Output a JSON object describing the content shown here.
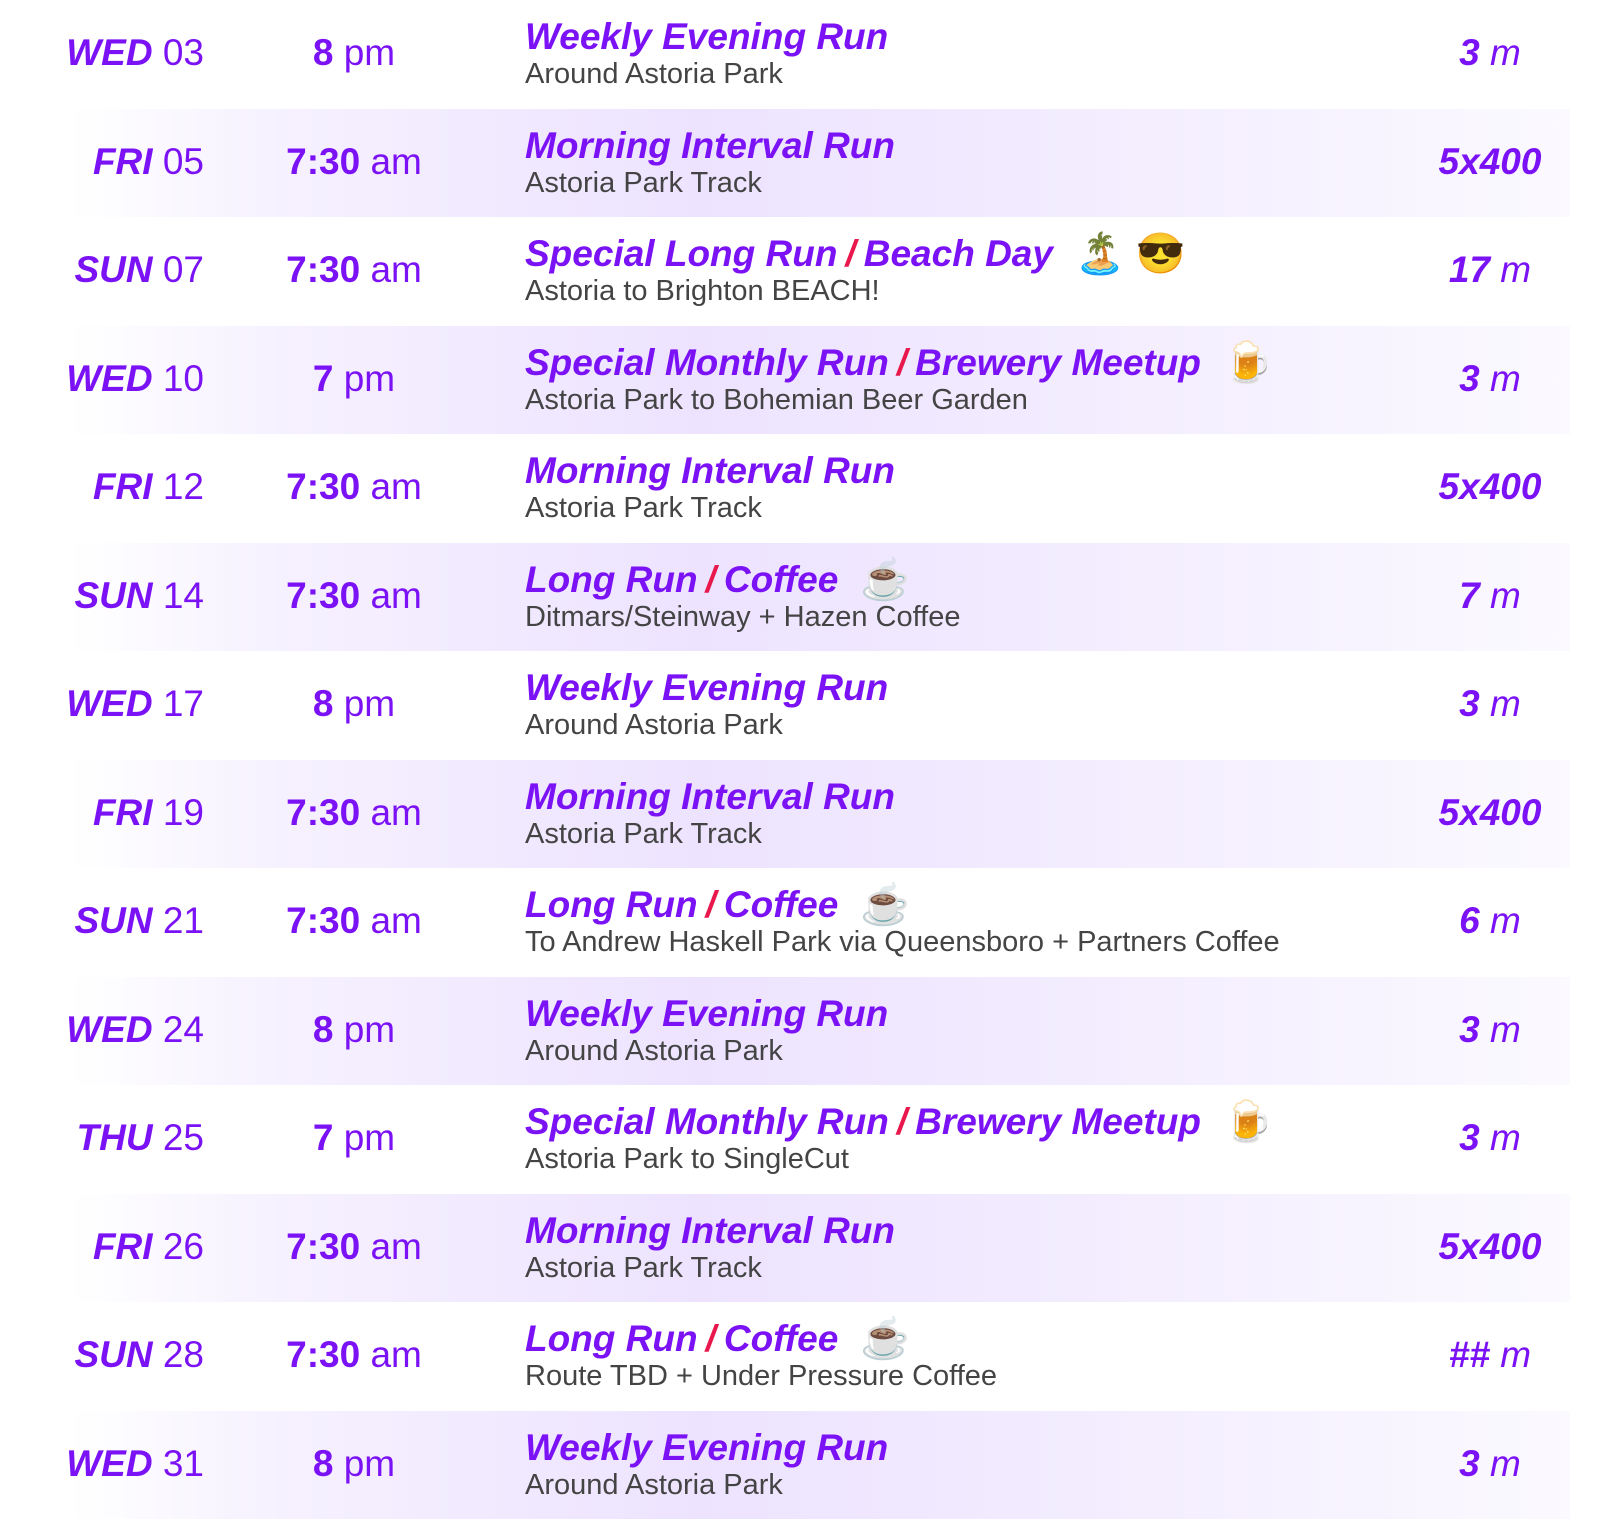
{
  "schedule": [
    {
      "day": "WED",
      "date": "03",
      "time": "8",
      "ampm": "pm",
      "title_a": "Weekly Evening Run",
      "title_b": "",
      "emoji": "",
      "subtitle": "Around Astoria Park",
      "distance": "3",
      "unit": "m",
      "shaded": false
    },
    {
      "day": "FRI",
      "date": "05",
      "time": "7:30",
      "ampm": "am",
      "title_a": "Morning Interval Run",
      "title_b": "",
      "emoji": "",
      "subtitle": "Astoria Park Track",
      "distance": "5x400",
      "unit": "",
      "shaded": true
    },
    {
      "day": "SUN",
      "date": "07",
      "time": "7:30",
      "ampm": "am",
      "title_a": "Special Long Run",
      "title_b": "Beach Day",
      "emoji": "🏝️ 😎",
      "subtitle": "Astoria to Brighton BEACH!",
      "distance": "17",
      "unit": "m",
      "shaded": false
    },
    {
      "day": "WED",
      "date": "10",
      "time": "7",
      "ampm": "pm",
      "title_a": "Special Monthly Run",
      "title_b": "Brewery Meetup",
      "emoji": "🍺",
      "subtitle": "Astoria Park to Bohemian Beer Garden",
      "distance": "3",
      "unit": "m",
      "shaded": true
    },
    {
      "day": "FRI",
      "date": "12",
      "time": "7:30",
      "ampm": "am",
      "title_a": "Morning Interval Run",
      "title_b": "",
      "emoji": "",
      "subtitle": "Astoria Park Track",
      "distance": "5x400",
      "unit": "",
      "shaded": false
    },
    {
      "day": "SUN",
      "date": "14",
      "time": "7:30",
      "ampm": "am",
      "title_a": "Long Run",
      "title_b": "Coffee",
      "emoji": "☕",
      "subtitle": "Ditmars/Steinway + Hazen Coffee",
      "distance": "7",
      "unit": "m",
      "shaded": true
    },
    {
      "day": "WED",
      "date": "17",
      "time": "8",
      "ampm": "pm",
      "title_a": "Weekly Evening Run",
      "title_b": "",
      "emoji": "",
      "subtitle": "Around Astoria Park",
      "distance": "3",
      "unit": "m",
      "shaded": false
    },
    {
      "day": "FRI",
      "date": "19",
      "time": "7:30",
      "ampm": "am",
      "title_a": "Morning Interval Run",
      "title_b": "",
      "emoji": "",
      "subtitle": "Astoria Park Track",
      "distance": "5x400",
      "unit": "",
      "shaded": true
    },
    {
      "day": "SUN",
      "date": "21",
      "time": "7:30",
      "ampm": "am",
      "title_a": "Long Run",
      "title_b": "Coffee",
      "emoji": "☕",
      "subtitle": "To Andrew Haskell Park via Queensboro + Partners Coffee",
      "distance": "6",
      "unit": "m",
      "shaded": false
    },
    {
      "day": "WED",
      "date": "24",
      "time": "8",
      "ampm": "pm",
      "title_a": "Weekly Evening Run",
      "title_b": "",
      "emoji": "",
      "subtitle": "Around Astoria Park",
      "distance": "3",
      "unit": "m",
      "shaded": true
    },
    {
      "day": "THU",
      "date": "25",
      "time": "7",
      "ampm": "pm",
      "title_a": "Special Monthly Run",
      "title_b": "Brewery Meetup",
      "emoji": "🍺",
      "subtitle": "Astoria Park to SingleCut",
      "distance": "3",
      "unit": "m",
      "shaded": false
    },
    {
      "day": "FRI",
      "date": "26",
      "time": "7:30",
      "ampm": "am",
      "title_a": "Morning Interval Run",
      "title_b": "",
      "emoji": "",
      "subtitle": "Astoria Park Track",
      "distance": "5x400",
      "unit": "",
      "shaded": true
    },
    {
      "day": "SUN",
      "date": "28",
      "time": "7:30",
      "ampm": "am",
      "title_a": "Long Run",
      "title_b": "Coffee",
      "emoji": "☕",
      "subtitle": "Route TBD + Under Pressure Coffee",
      "distance": "##",
      "unit": "m",
      "shaded": false
    },
    {
      "day": "WED",
      "date": "31",
      "time": "8",
      "ampm": "pm",
      "title_a": "Weekly Evening Run",
      "title_b": "",
      "emoji": "",
      "subtitle": "Around Astoria Park",
      "distance": "3",
      "unit": "m",
      "shaded": true
    }
  ],
  "separator": "/",
  "colors": {
    "accent": "#7b12f5",
    "separator": "#e8184d",
    "subtitle": "#444444",
    "row_shade": "#ede3ff"
  }
}
